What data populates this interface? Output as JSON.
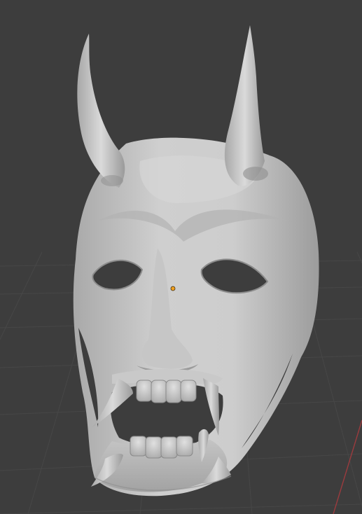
{
  "viewport": {
    "background": "#3d3d3d",
    "grid_color": "#474747",
    "axis_x_color": "#9b3b3e",
    "origin_color": "#f0a020"
  },
  "object": {
    "type": "oni-mask-mesh",
    "base_color": "#bdbdbd",
    "shadow_color": "#8e8e8e",
    "highlight_color": "#dcdcdc"
  }
}
